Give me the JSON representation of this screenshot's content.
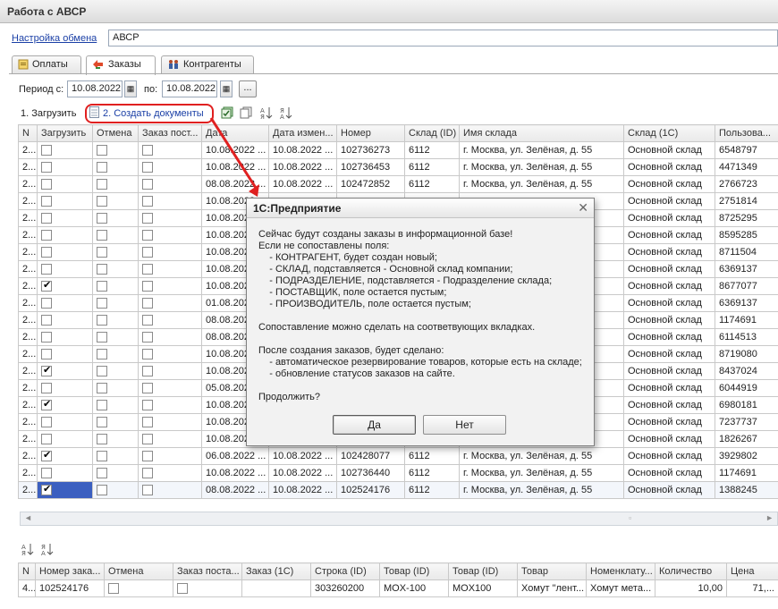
{
  "window": {
    "title": "Работа с АВСР"
  },
  "exchange": {
    "link_label": "Настройка обмена",
    "value": "АВСР"
  },
  "tabs": [
    {
      "label": "Оплаты",
      "icon": "payments-icon"
    },
    {
      "label": "Заказы",
      "icon": "orders-icon"
    },
    {
      "label": "Контрагенты",
      "icon": "contractors-icon"
    }
  ],
  "period": {
    "from_label": "Период с:",
    "from_value": "10.08.2022",
    "to_label": "по:",
    "to_value": "10.08.2022",
    "ellipsis": "..."
  },
  "toolbar": {
    "load_label": "1. Загрузить",
    "create_label": "2. Создать документы"
  },
  "orders": {
    "columns": [
      "N",
      "Загрузить",
      "Отмена",
      "Заказ пост...",
      "Дата",
      "Дата измен...",
      "Номер",
      "Склад (ID)",
      "Имя склада",
      "Склад (1С)",
      "Пользова..."
    ],
    "rows": [
      {
        "n": "2...",
        "load": false,
        "cancel": false,
        "post": false,
        "date": "10.08.2022 ...",
        "date_mod": "10.08.2022 ...",
        "number": "102736273",
        "wh_id": "6112",
        "wh_name": "г. Москва, ул. Зелёная, д. 55",
        "wh_1c": "Основной склад",
        "user": "6548797"
      },
      {
        "n": "2...",
        "load": false,
        "cancel": false,
        "post": false,
        "date": "10.08.2022 ...",
        "date_mod": "10.08.2022 ...",
        "number": "102736453",
        "wh_id": "6112",
        "wh_name": "г. Москва, ул. Зелёная, д. 55",
        "wh_1c": "Основной склад",
        "user": "4471349"
      },
      {
        "n": "2...",
        "load": false,
        "cancel": false,
        "post": false,
        "date": "08.08.2022 ...",
        "date_mod": "10.08.2022 ...",
        "number": "102472852",
        "wh_id": "6112",
        "wh_name": "г. Москва, ул. Зелёная, д. 55",
        "wh_1c": "Основной склад",
        "user": "2766723"
      },
      {
        "n": "2...",
        "load": false,
        "cancel": false,
        "post": false,
        "date": "10.08.2022 ...",
        "date_mod": "",
        "number": "",
        "wh_id": "",
        "wh_name": "",
        "wh_1c": "Основной склад",
        "user": "2751814"
      },
      {
        "n": "2...",
        "load": false,
        "cancel": false,
        "post": false,
        "date": "10.08.2022 ...",
        "date_mod": "",
        "number": "",
        "wh_id": "",
        "wh_name": "",
        "wh_1c": "Основной склад",
        "user": "8725295"
      },
      {
        "n": "2...",
        "load": false,
        "cancel": false,
        "post": false,
        "date": "10.08.2022 ...",
        "date_mod": "",
        "number": "",
        "wh_id": "",
        "wh_name": "",
        "wh_1c": "Основной склад",
        "user": "8595285"
      },
      {
        "n": "2...",
        "load": false,
        "cancel": false,
        "post": false,
        "date": "10.08.2022 ...",
        "date_mod": "",
        "number": "",
        "wh_id": "",
        "wh_name": "",
        "wh_1c": "Основной склад",
        "user": "8711504"
      },
      {
        "n": "2...",
        "load": false,
        "cancel": false,
        "post": false,
        "date": "10.08.2022 ...",
        "date_mod": "",
        "number": "",
        "wh_id": "",
        "wh_name": "",
        "wh_1c": "Основной склад",
        "user": "6369137"
      },
      {
        "n": "2...",
        "load": true,
        "cancel": false,
        "post": false,
        "date": "10.08.2022 ...",
        "date_mod": "",
        "number": "",
        "wh_id": "",
        "wh_name": "",
        "wh_1c": "Основной склад",
        "user": "8677077"
      },
      {
        "n": "2...",
        "load": false,
        "cancel": false,
        "post": false,
        "date": "01.08.2022 ...",
        "date_mod": "",
        "number": "",
        "wh_id": "",
        "wh_name": "",
        "wh_1c": "Основной склад",
        "user": "6369137"
      },
      {
        "n": "2...",
        "load": false,
        "cancel": false,
        "post": false,
        "date": "08.08.2022 ...",
        "date_mod": "",
        "number": "",
        "wh_id": "",
        "wh_name": "",
        "wh_1c": "Основной склад",
        "user": "1174691"
      },
      {
        "n": "2...",
        "load": false,
        "cancel": false,
        "post": false,
        "date": "08.08.2022 ...",
        "date_mod": "",
        "number": "",
        "wh_id": "",
        "wh_name": "",
        "wh_1c": "Основной склад",
        "user": "6114513"
      },
      {
        "n": "2...",
        "load": false,
        "cancel": false,
        "post": false,
        "date": "10.08.2022 ...",
        "date_mod": "",
        "number": "",
        "wh_id": "",
        "wh_name": "",
        "wh_1c": "Основной склад",
        "user": "8719080"
      },
      {
        "n": "2...",
        "load": true,
        "cancel": false,
        "post": false,
        "date": "10.08.2022 ...",
        "date_mod": "",
        "number": "",
        "wh_id": "",
        "wh_name": "",
        "wh_1c": "Основной склад",
        "user": "8437024"
      },
      {
        "n": "2...",
        "load": false,
        "cancel": false,
        "post": false,
        "date": "05.08.2022 ...",
        "date_mod": "",
        "number": "",
        "wh_id": "",
        "wh_name": "",
        "wh_1c": "Основной склад",
        "user": "6044919"
      },
      {
        "n": "2...",
        "load": true,
        "cancel": false,
        "post": false,
        "date": "10.08.2022 ...",
        "date_mod": "",
        "number": "",
        "wh_id": "",
        "wh_name": "",
        "wh_1c": "Основной склад",
        "user": "6980181"
      },
      {
        "n": "2...",
        "load": false,
        "cancel": false,
        "post": false,
        "date": "10.08.2022 ...",
        "date_mod": "",
        "number": "",
        "wh_id": "",
        "wh_name": "",
        "wh_1c": "Основной склад",
        "user": "7237737"
      },
      {
        "n": "2...",
        "load": false,
        "cancel": false,
        "post": false,
        "date": "10.08.2022 ...",
        "date_mod": "",
        "number": "",
        "wh_id": "",
        "wh_name": "",
        "wh_1c": "Основной склад",
        "user": "1826267"
      },
      {
        "n": "2...",
        "load": true,
        "cancel": false,
        "post": false,
        "date": "06.08.2022 ...",
        "date_mod": "10.08.2022 ...",
        "number": "102428077",
        "wh_id": "6112",
        "wh_name": "г. Москва, ул. Зелёная, д. 55",
        "wh_1c": "Основной склад",
        "user": "3929802"
      },
      {
        "n": "2...",
        "load": false,
        "cancel": false,
        "post": false,
        "date": "10.08.2022 ...",
        "date_mod": "10.08.2022 ...",
        "number": "102736440",
        "wh_id": "6112",
        "wh_name": "г. Москва, ул. Зелёная, д. 55",
        "wh_1c": "Основной склад",
        "user": "1174691"
      },
      {
        "n": "2...",
        "load": true,
        "cancel": false,
        "post": false,
        "date": "08.08.2022 ...",
        "date_mod": "10.08.2022 ...",
        "number": "102524176",
        "wh_id": "6112",
        "wh_name": "г. Москва, ул. Зелёная, д. 55",
        "wh_1c": "Основной склад",
        "user": "1388245"
      }
    ]
  },
  "items": {
    "columns": [
      "N",
      "Номер зака...",
      "Отмена",
      "Заказ поста...",
      "Заказ (1С)",
      "Строка (ID)",
      "Товар (ID)",
      "Товар (ID)",
      "Товар",
      "Номенклату...",
      "Количество",
      "Цена"
    ],
    "rows": [
      {
        "n": "4...",
        "order": "102524176",
        "cancel": false,
        "post": false,
        "order_1c": "",
        "line_id": "303260200",
        "goods_id": "MOX-100",
        "goods_id2": "MOX100",
        "goods": "Хомут \"лент...",
        "nomen": "Хомут мета...",
        "qty": "10,00",
        "price": "71,..."
      }
    ]
  },
  "dialog": {
    "title": "1С:Предприятие",
    "lines": [
      "Сейчас будут созданы заказы в информационной базе!",
      "Если не сопоставлены поля:",
      "    - КОНТРАГЕНТ, будет создан новый;",
      "    - СКЛАД, подставляется - Основной склад компании;",
      "    - ПОДРАЗДЕЛЕНИЕ, подставляется - Подразделение склада;",
      "    - ПОСТАВЩИК, поле остается пустым;",
      "    - ПРОИЗВОДИТЕЛЬ, поле остается пустым;",
      "",
      "Сопоставление можно сделать на соответвующих вкладках.",
      "",
      "После создания заказов, будет сделано:",
      "    - автоматическое резервирование товаров, которые есть на складе;",
      "    - обновление статусов заказов на сайте.",
      "",
      "Продолжить?"
    ],
    "yes_label": "Да",
    "no_label": "Нет"
  },
  "colors": {
    "accent_link": "#1a3fa6",
    "highlight_ring": "#e02020",
    "selection": "#3b5fc0"
  }
}
